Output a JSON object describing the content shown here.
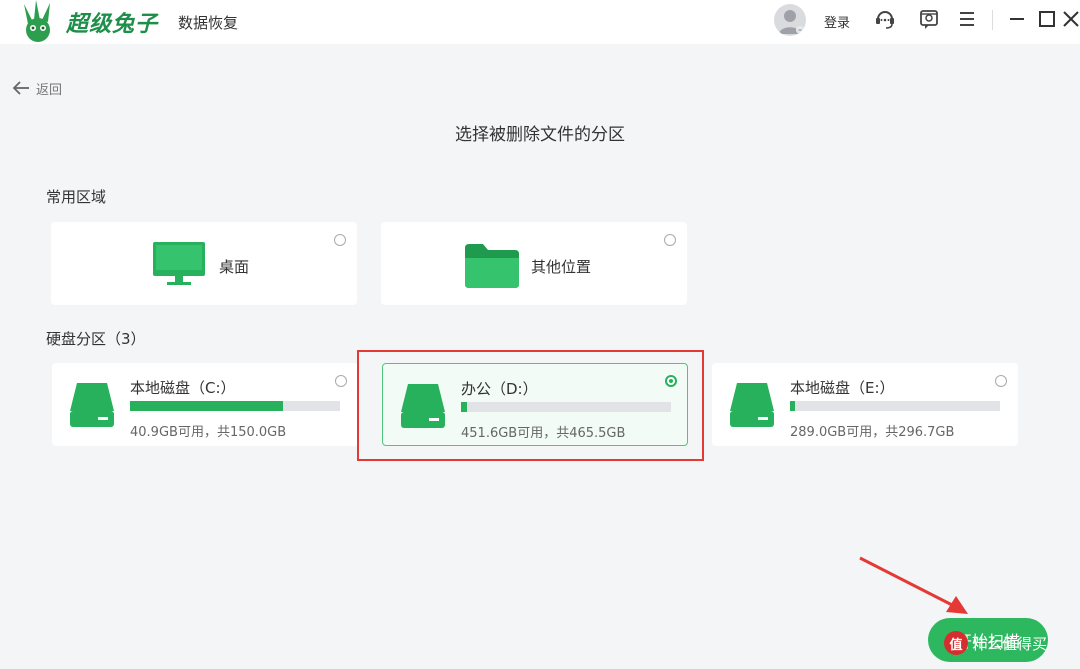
{
  "app": {
    "brand_name": "超级兔子",
    "brand_sub": "数据恢复",
    "login_label": "登录"
  },
  "nav": {
    "back_label": "返回"
  },
  "page": {
    "title": "选择被删除文件的分区"
  },
  "common_section": {
    "label": "常用区域",
    "items": [
      {
        "label": "桌面",
        "icon": "monitor-icon",
        "selected": false
      },
      {
        "label": "其他位置",
        "icon": "folder-icon",
        "selected": false
      }
    ]
  },
  "disk_section": {
    "label": "硬盘分区（3）",
    "partitions": [
      {
        "name": "本地磁盘（C:）",
        "capacity": "40.9GB可用，共150.0GB",
        "used_fraction": 0.727,
        "selected": false
      },
      {
        "name": "办公（D:）",
        "capacity": "451.6GB可用，共465.5GB",
        "used_fraction": 0.03,
        "selected": true
      },
      {
        "name": "本地磁盘（E:）",
        "capacity": "289.0GB可用，共296.7GB",
        "used_fraction": 0.026,
        "selected": false
      }
    ]
  },
  "actions": {
    "scan_label": "开始扫描"
  },
  "watermark": {
    "text": "什么值得买",
    "badge": "值"
  },
  "colors": {
    "accent": "#27b15c",
    "highlight": "#e53935",
    "background": "#f4f5f7"
  }
}
